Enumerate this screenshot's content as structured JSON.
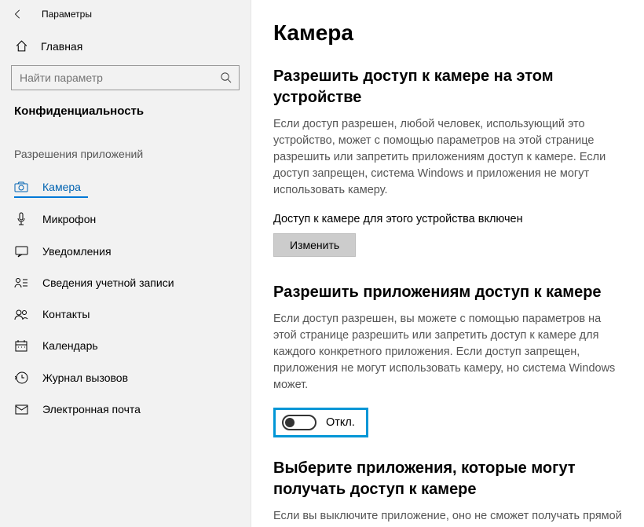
{
  "window_title": "Параметры",
  "home_label": "Главная",
  "search_placeholder": "Найти параметр",
  "section_title": "Конфиденциальность",
  "group_label": "Разрешения приложений",
  "nav": [
    {
      "label": "Камера"
    },
    {
      "label": "Микрофон"
    },
    {
      "label": "Уведомления"
    },
    {
      "label": "Сведения учетной записи"
    },
    {
      "label": "Контакты"
    },
    {
      "label": "Календарь"
    },
    {
      "label": "Журнал вызовов"
    },
    {
      "label": "Электронная почта"
    }
  ],
  "page": {
    "title": "Камера",
    "s1_heading": "Разрешить доступ к камере на этом устройстве",
    "s1_body": "Если доступ разрешен, любой человек, использующий это устройство, может с помощью параметров на этой странице разрешить или запретить приложениям доступ к камере. Если доступ запрещен, система Windows и приложения не могут использовать камеру.",
    "s1_status": "Доступ к камере для этого устройства включен",
    "s1_button": "Изменить",
    "s2_heading": "Разрешить приложениям доступ к камере",
    "s2_body": "Если доступ разрешен, вы можете с помощью параметров на этой странице разрешить или запретить доступ к камере для каждого конкретного приложения. Если доступ запрещен, приложения не могут использовать камеру, но система Windows может.",
    "toggle_label": "Откл.",
    "toggle_state": "off",
    "s3_heading": "Выберите приложения, которые могут получать доступ к камере",
    "s3_body": "Если вы выключите приложение, оно не сможет получать прямой"
  }
}
